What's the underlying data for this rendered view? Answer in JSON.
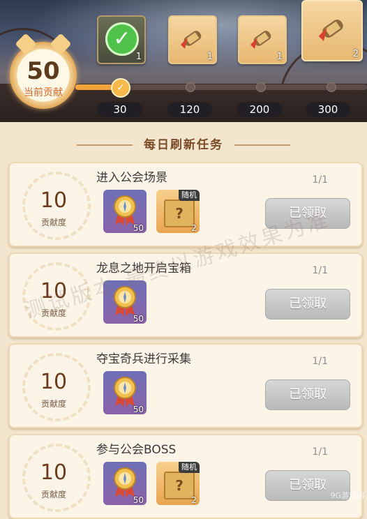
{
  "contribution": {
    "value": "50",
    "label": "当前贡献"
  },
  "progress": {
    "current": 50,
    "max": 300,
    "fill_fraction": 0.13
  },
  "milestones": [
    {
      "value": "30",
      "reward_count": "1",
      "claimed": true
    },
    {
      "value": "120",
      "reward_count": "1",
      "claimed": false
    },
    {
      "value": "200",
      "reward_count": "1",
      "claimed": false
    },
    {
      "value": "300",
      "reward_count": "2",
      "claimed": false
    }
  ],
  "section_title": "每日刷新任务",
  "score_label": "贡献度",
  "claimed_label": "已领取",
  "random_tag": "随机",
  "tasks": [
    {
      "points": "10",
      "name": "进入公会场景",
      "progress": "1/1",
      "rewards": [
        {
          "kind": "medal",
          "qty": "50"
        },
        {
          "kind": "box",
          "qty": "2",
          "tag": "随机"
        }
      ]
    },
    {
      "points": "10",
      "name": "龙息之地开启宝箱",
      "progress": "1/1",
      "rewards": [
        {
          "kind": "medal",
          "qty": "50"
        }
      ]
    },
    {
      "points": "10",
      "name": "夺宝奇兵进行采集",
      "progress": "1/1",
      "rewards": [
        {
          "kind": "medal",
          "qty": "50"
        }
      ]
    },
    {
      "points": "10",
      "name": "参与公会BOSS",
      "progress": "1/1",
      "rewards": [
        {
          "kind": "medal",
          "qty": "50"
        },
        {
          "kind": "box",
          "qty": "2",
          "tag": "随机"
        }
      ]
    }
  ],
  "watermark": "测试版本  最终以游戏效果为准",
  "corner_mark": "9G游戏网",
  "colors": {
    "accent": "#f2a33a",
    "button_disabled": "#c4c4c4",
    "card_bg": "#fbf4e7"
  }
}
